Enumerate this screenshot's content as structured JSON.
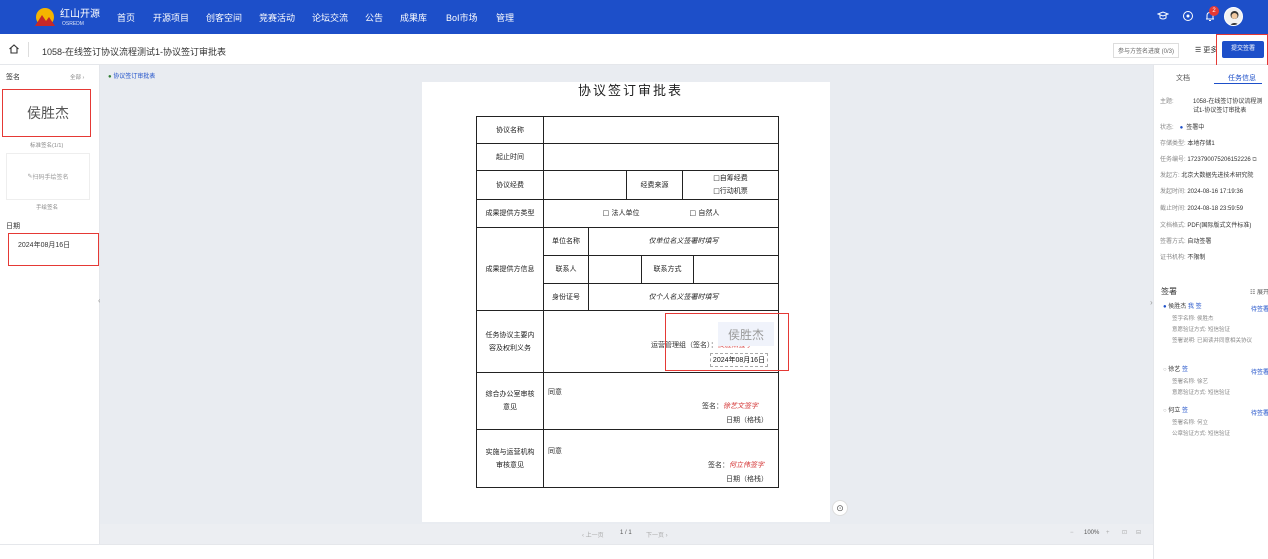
{
  "app": {
    "logo_text": "红山开源",
    "logo_sub": "OSREDM"
  },
  "nav": [
    "首页",
    "开源项目",
    "创客空间",
    "竞赛活动",
    "论坛交流",
    "公告",
    "成果库",
    "BoI市场",
    "管理"
  ],
  "notifications": {
    "count": "2"
  },
  "toolbar": {
    "title": "1058-在线签订协议流程测试1-协议签订审批表",
    "progress": "参与方签名进度 (0/3)",
    "more": "更多",
    "submit": "提交签署"
  },
  "left": {
    "sign_label": "签名",
    "all_label": "全部",
    "sig_name": "侯胜杰",
    "sig_caption": "标准签名(1/1)",
    "handwrite_button": "扫码手绘签名",
    "handwrite_caption": "手绘签名",
    "date_label": "日期",
    "date_value": "2024年08月16日"
  },
  "viewer": {
    "file_tab": "协议签订审批表",
    "page_title": "协议签订审批表",
    "pager": {
      "prev": "上一页",
      "current": "1 / 1",
      "next": "下一页",
      "zoom": "100%"
    }
  },
  "form": {
    "name_label": "协议名称",
    "period_label": "起止时间",
    "fund_label": "协议经费",
    "fund_source_label": "经费来源",
    "fund_option1": "□自筹经费",
    "fund_option2": "□行动机票",
    "provider_type_label": "成果提供方类型",
    "legal_option": "□ 法人单位",
    "natural_option": "□ 自然人",
    "provider_info_label": "成果提供方信息",
    "unit_name_label": "单位名称",
    "unit_name_value": "仅单位名义签署时填写",
    "contact_label": "联系人",
    "contact_method_label": "联系方式",
    "id_label": "身份证号",
    "id_value": "仅个人名义签署时填写",
    "content_label": "任务协议主要内容及权利义务",
    "ops_sign_label": "运营管理组（签名）：",
    "ops_sign_value": "侯胜杰签字",
    "stamp_sig": "侯胜杰",
    "stamp_date": "2024年08月16日",
    "office_label": "综合办公室审核意见",
    "office_opinion": "同意",
    "office_sign_label": "签名：",
    "office_sign_value": "徐艺文签字",
    "office_date": "日期（格栈）",
    "op_label": "实施与运营机构审核意见",
    "op_opinion": "同意",
    "op_sign_label": "签名：",
    "op_sign_value": "何立伟签字",
    "op_date": "日期（格栈）"
  },
  "right": {
    "tab_doc": "文档",
    "tab_task": "任务信息",
    "info": [
      {
        "label": "主题:",
        "value": "1058-在线签订协议流程测试1-协议签订审批表"
      },
      {
        "label": "状态:",
        "value": "签署中"
      },
      {
        "label": "存储类型:",
        "value": "本地存储1"
      },
      {
        "label": "任务编号:",
        "value": "1723790075206152226"
      },
      {
        "label": "发起方:",
        "value": "北京大数据先进技术研究院"
      },
      {
        "label": "发起时间:",
        "value": "2024-08-16 17:19:36"
      },
      {
        "label": "截止时间:",
        "value": "2024-08-18 23:59:59"
      },
      {
        "label": "文档格式:",
        "value": "PDF(国际版式文件标准)"
      },
      {
        "label": "签署方式:",
        "value": "自动签署"
      },
      {
        "label": "证书机构:",
        "value": "不限制"
      }
    ],
    "signers_title": "签署",
    "signers_toggle": "展开",
    "signers": [
      {
        "name": "侯胜杰",
        "tag1": "我",
        "tag2": "签",
        "link": "待签署",
        "details": [
          "签字名称: 侯胜杰",
          "意愿验证方式: 短信验证",
          "签署说明: 已阅读并同意相关协议"
        ]
      },
      {
        "name": "徐艺",
        "tag1": "签",
        "link": "待签署",
        "details": [
          "签署名称: 徐艺",
          "意愿验证方式: 短信验证"
        ]
      },
      {
        "name": "何立",
        "tag1": "签",
        "link": "待签署",
        "details": [
          "签署名称: 何立",
          "公章验证方式: 短信验证"
        ]
      }
    ]
  }
}
